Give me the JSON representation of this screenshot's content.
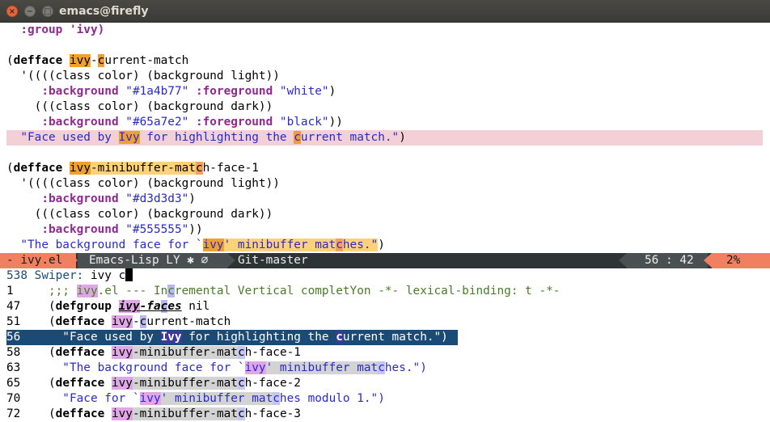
{
  "window": {
    "title": "emacs@firefly"
  },
  "editor": {
    "l1": "  :group 'ivy)",
    "d1_a": "(",
    "d1_kw": "defface",
    "d1_sp": " ",
    "d1_n1": "ivy",
    "d1_n2": "-",
    "d1_n3": "c",
    "d1_n4": "urrent-match",
    "d2": "  '((((class color) (background light))",
    "d3_a": "     ",
    "d3_k1": ":background",
    "d3_s1": " \"#1a4b77\" ",
    "d3_k2": ":foreground",
    "d3_s2": " \"white\"",
    "d3_e": ")",
    "d4": "    (((class color) (background dark))",
    "d5_a": "     ",
    "d5_k1": ":background",
    "d5_s1": " \"#65a7e2\" ",
    "d5_k2": ":foreground",
    "d5_s2": " \"black\"",
    "d5_e": "))",
    "d6_a": "  ",
    "d6_s1": "\"Face used by ",
    "d6_ivy": "Ivy",
    "d6_s2": " for highlighting the ",
    "d6_c": "c",
    "d6_s3": "urrent match.\"",
    "d6_e": ")",
    "m1_a": "(",
    "m1_kw": "defface",
    "m1_sp": " ",
    "m1_n1": "ivy",
    "m1_n2": "-minibuffer-mat",
    "m1_n3": "c",
    "m1_n4": "h-face-1",
    "m2": "  '((((class color) (background light))",
    "m3_a": "     ",
    "m3_k1": ":background",
    "m3_s1": " \"#d3d3d3\"",
    "m3_e": ")",
    "m4": "    (((class color) (background dark))",
    "m5_a": "     ",
    "m5_k1": ":background",
    "m5_s1": " \"#555555\"",
    "m5_e": "))",
    "m6_a": "  ",
    "m6_s1": "\"The background face for `",
    "m6_ivy": "ivy",
    "m6_s2": "' minibuffer mat",
    "m6_c": "c",
    "m6_s3": "hes.\"",
    "m6_e": ")"
  },
  "modeline": {
    "state": "- ivy.el ",
    "mode": "Emacs-Lisp LY ",
    "mode_icons": "✱ ⌀",
    "vc": "Git-master",
    "position": "56 : 42",
    "percent": "2%"
  },
  "swiper": {
    "count": "538",
    "prompt": " Swiper: ",
    "input": "ivy c",
    "rows": [
      {
        "num": "1   ",
        "pre": "  ;;; ",
        "h1": "ivy",
        "t1": ".el --- In",
        "h2": "c",
        "t2": "remental Vertical completYon -*- lexical-binding: t -*-"
      },
      {
        "num": "47  ",
        "pre": "  (",
        "kw": "defgroup",
        "sp": " ",
        "h1": "ivy",
        "t1": "-fa",
        "h2": "c",
        "t2": "es",
        "end": " nil"
      },
      {
        "num": "51  ",
        "pre": "  (",
        "kw": "defface",
        "sp": " ",
        "h1": "ivy",
        "t1": "-",
        "h2": "c",
        "t2": "urrent-match"
      },
      {
        "num": "56  ",
        "pre": "    \"Face used by ",
        "h1": "Ivy",
        "t1": " for highlighting the ",
        "h2": "c",
        "t2": "urrent match.\")"
      },
      {
        "num": "58  ",
        "pre": "  (",
        "kw": "defface",
        "sp": " ",
        "h1": "ivy",
        "t1": "-minibuffer-mat",
        "h2": "c",
        "t2": "h-face-1"
      },
      {
        "num": "63  ",
        "pre": "    \"The background face for `",
        "h1": "ivy",
        "t1": "' minibuffer mat",
        "h2": "c",
        "t2": "hes.\")"
      },
      {
        "num": "65  ",
        "pre": "  (",
        "kw": "defface",
        "sp": " ",
        "h1": "ivy",
        "t1": "-minibuffer-mat",
        "h2": "c",
        "t2": "h-face-2"
      },
      {
        "num": "70  ",
        "pre": "    \"Face for `",
        "h1": "ivy",
        "t1": "' minibuffer mat",
        "h2": "c",
        "t2": "hes modulo 1.\")"
      },
      {
        "num": "72  ",
        "pre": "  (",
        "kw": "defface",
        "sp": " ",
        "h1": "ivy",
        "t1": "-minibuffer-mat",
        "h2": "c",
        "t2": "h-face-3"
      }
    ]
  },
  "colors": {
    "modeline_bg": "#2e3436",
    "accent": "#f08060",
    "selection": "#1a4b77"
  }
}
